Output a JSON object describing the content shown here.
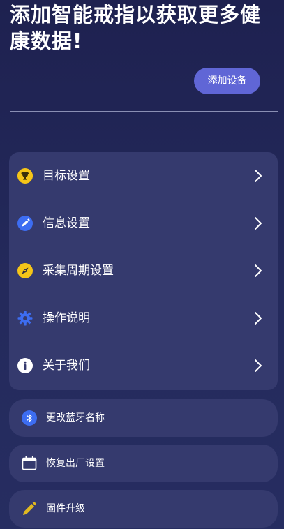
{
  "header": {
    "headline": "添加智能戒指以获取更多健康数据!",
    "add_device_label": "添加设备"
  },
  "menu": {
    "items": [
      {
        "label": "目标设置",
        "icon": "trophy-icon",
        "icon_color": "#f5c518"
      },
      {
        "label": "信息设置",
        "icon": "pencil-icon",
        "icon_color": "#3d6df2"
      },
      {
        "label": "采集周期设置",
        "icon": "compass-icon",
        "icon_color": "#f5c518"
      },
      {
        "label": "操作说明",
        "icon": "gear-icon",
        "icon_color": "#3d6df2"
      },
      {
        "label": "关于我们",
        "icon": "info-icon",
        "icon_color": "#ffffff"
      }
    ]
  },
  "actions": {
    "rename_bluetooth": {
      "label": "更改蓝牙名称",
      "icon": "bluetooth-icon",
      "icon_color": "#3d6df2"
    },
    "factory_reset": {
      "label": "恢复出厂设置",
      "icon": "calendar-icon",
      "icon_color": "#ffffff"
    },
    "firmware_upgrade": {
      "label": "固件升级",
      "icon": "pencil-icon",
      "icon_color": "#e0b820"
    }
  },
  "colors": {
    "background": "#1e2150",
    "card": "#353a6e",
    "accent_button": "#6066d6"
  }
}
